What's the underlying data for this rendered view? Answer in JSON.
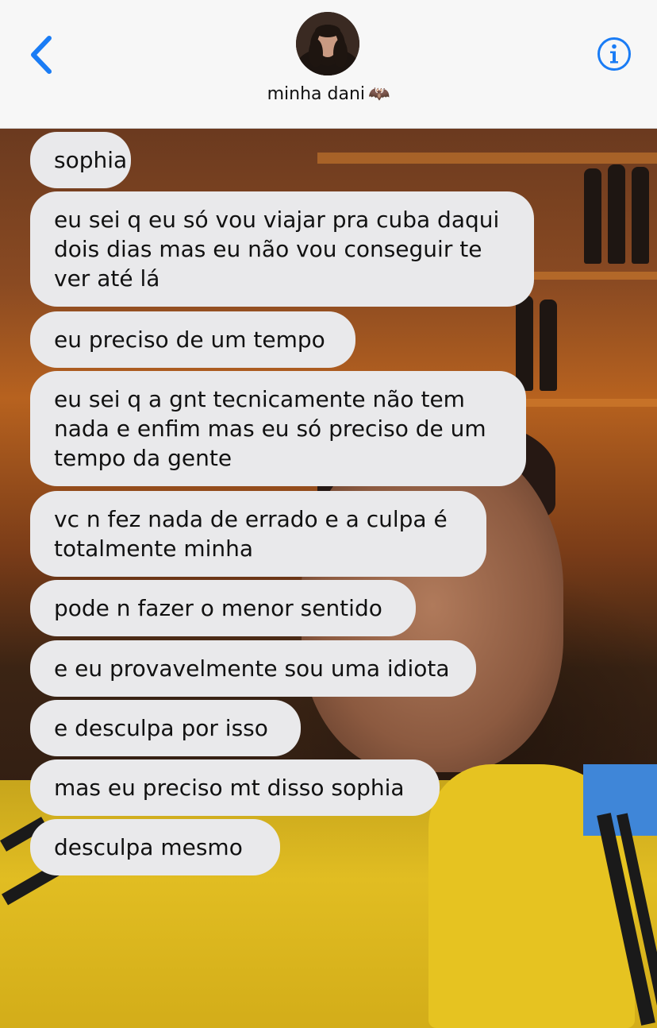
{
  "header": {
    "contact_name": "minha dani",
    "contact_emoji": "🦇",
    "back_icon": "chevron-left-icon",
    "info_icon": "info-circle-icon",
    "accent_color": "#1a7cf5"
  },
  "messages": [
    {
      "text": "sophia"
    },
    {
      "text": "eu sei q eu só vou viajar pra cuba daqui dois dias mas eu não vou conseguir te ver até lá"
    },
    {
      "text": "eu preciso de um tempo"
    },
    {
      "text": "eu sei q a gnt tecnicamente não tem nada e enfim mas eu só preciso de um tempo da gente"
    },
    {
      "text": "vc n fez nada de errado e a culpa é totalmente minha"
    },
    {
      "text": "pode n fazer o menor sentido"
    },
    {
      "text": "e eu provavelmente sou uma idiota"
    },
    {
      "text": "e desculpa por isso"
    },
    {
      "text": "mas eu preciso mt disso sophia"
    },
    {
      "text": "desculpa mesmo"
    }
  ]
}
